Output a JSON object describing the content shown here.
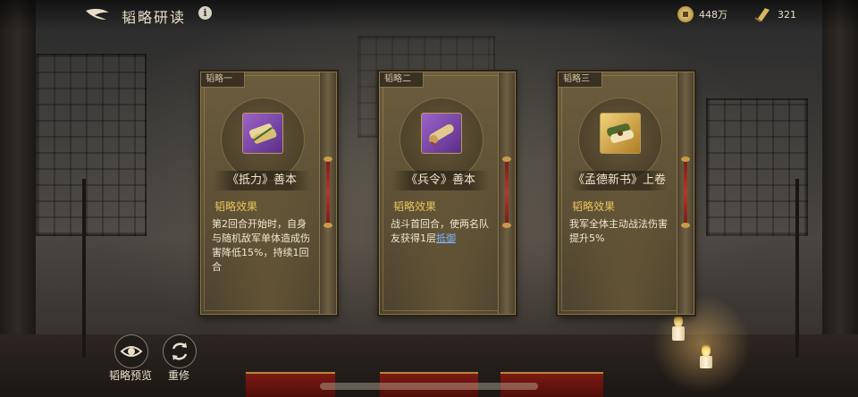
{
  "header": {
    "title": "韬略研读",
    "info_glyph": "i",
    "resources": [
      {
        "icon": "coin-icon",
        "value": "448万"
      },
      {
        "icon": "scroll-icon",
        "value": "321"
      }
    ]
  },
  "cards": [
    {
      "tab": "韬略一",
      "icon": "scroll-bundle-icon",
      "rarity_color": "#7a46a8",
      "name": "《抵力》善本",
      "effect_title": "韬略效果",
      "effect_text": "第2回合开始时，自身与随机敌军单体造成伤害降低15%，持续1回合",
      "effect_link": ""
    },
    {
      "tab": "韬略二",
      "icon": "scroll-roll-icon",
      "rarity_color": "#7a46a8",
      "name": "《兵令》善本",
      "effect_title": "韬略效果",
      "effect_text": "战斗首回合，使两名队友获得1层",
      "effect_link": "抵御"
    },
    {
      "tab": "韬略三",
      "icon": "scroll-bundle-icon",
      "rarity_color": "#d6a63e",
      "name": "《孟德新书》上卷",
      "effect_title": "韬略效果",
      "effect_text": "我军全体主动战法伤害提升5%",
      "effect_link": ""
    }
  ],
  "actions": {
    "preview_label": "韬略预览",
    "reroll_label": "重修"
  },
  "colors": {
    "accent_gold": "#e6c45b",
    "link_blue": "#7fb4ff",
    "rail_red": "#b3382b"
  }
}
